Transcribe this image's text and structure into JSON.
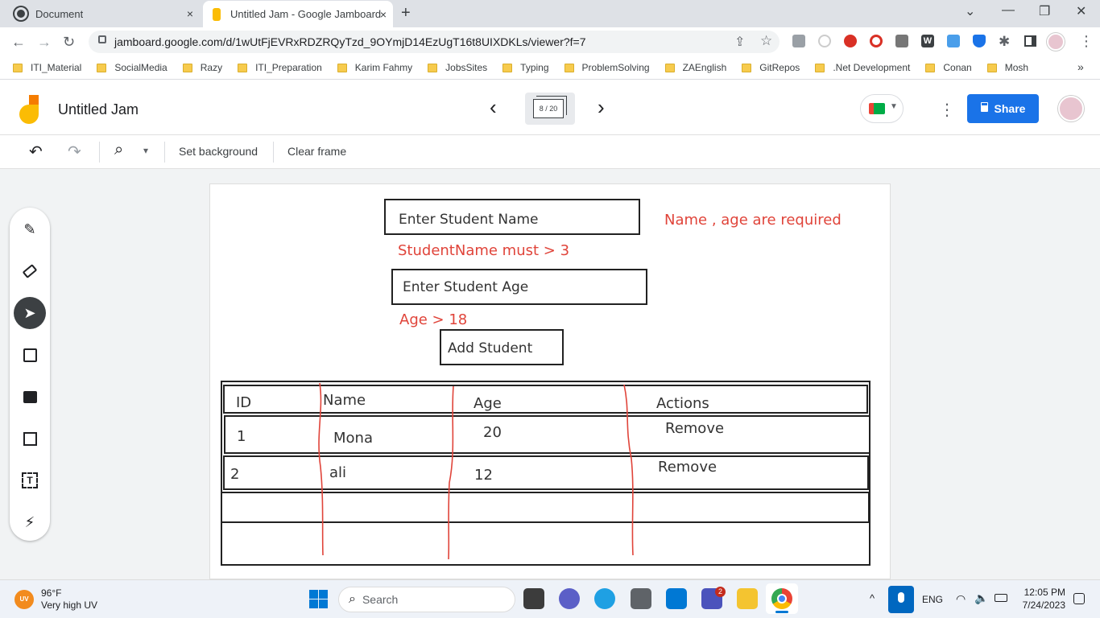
{
  "browser": {
    "tabs": [
      {
        "title": "Document",
        "close": "×"
      },
      {
        "title": "Untitled Jam - Google Jamboard",
        "close": "×"
      }
    ],
    "new_tab": "+",
    "window_controls": {
      "minimize": "—",
      "maximize": "❐",
      "close": "✕",
      "chevron": "⌄"
    },
    "nav": {
      "back": "←",
      "forward": "→",
      "reload": "↻"
    },
    "url": "jamboard.google.com/d/1wUtFjEVRxRDZRQyTzd_9OYmjD14EzUgT16t8UIXDKLs/viewer?f=7",
    "bookmarks": [
      "ITI_Material",
      "SocialMedia",
      "Razy",
      "ITI_Preparation",
      "Karim Fahmy",
      "JobsSites",
      "Typing",
      "ProblemSolving",
      "ZAEnglish",
      "GitRepos",
      ".Net Development",
      "Conan",
      "Mosh"
    ],
    "bookmarks_overflow": "»"
  },
  "app": {
    "title": "Untitled Jam",
    "frame_counter": "8 / 20",
    "prev": "‹",
    "next": "›",
    "share_label": "Share",
    "more": "⋮"
  },
  "toolbar": {
    "undo": "↶",
    "redo": "↷",
    "zoom": "⌕",
    "zoom_caret": "▾",
    "set_background": "Set background",
    "clear_frame": "Clear frame"
  },
  "board": {
    "name_input": "Enter Student Name",
    "name_error": "StudentName must > 3",
    "required_note": "Name , age are required",
    "age_input": "Enter Student Age",
    "age_error": "Age > 18",
    "add_button": "Add Student",
    "table": {
      "headers": [
        "ID",
        "Name",
        "Age",
        "Actions"
      ],
      "rows": [
        {
          "id": "1",
          "name": "Mona",
          "age": "20",
          "action": "Remove"
        },
        {
          "id": "2",
          "name": "ali",
          "age": "12",
          "action": "Remove"
        }
      ]
    }
  },
  "taskbar": {
    "weather_temp": "96°F",
    "weather_desc": "Very high UV",
    "weather_badge": "UV",
    "search": "Search",
    "lang": "ENG",
    "time": "12:05 PM",
    "date": "7/24/2023",
    "teams_badge": "2",
    "tray_caret": "^"
  },
  "colors": {
    "accent_blue": "#1a73e8",
    "annotation_red": "#e0443a",
    "jamboard_yellow": "#fbbc04",
    "jamboard_orange": "#f57c00"
  }
}
